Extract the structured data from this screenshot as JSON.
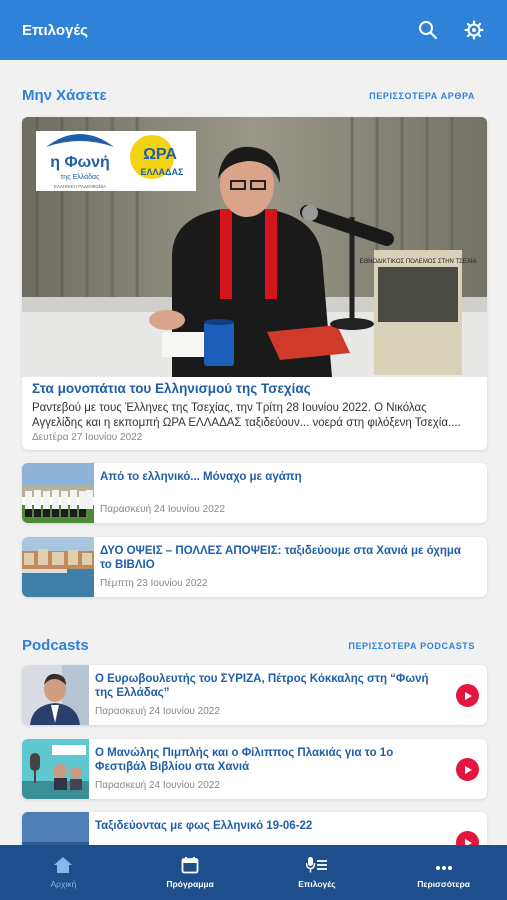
{
  "topbar": {
    "title": "Επιλογές",
    "search_icon": "search-icon",
    "settings_icon": "gear-icon"
  },
  "featured": {
    "title": "Μην Χάσετε",
    "more_label": "ΠΕΡΙΣΣΟΤΕΡΑ ΑΡΘΡΑ",
    "hero": {
      "title": "Στα μονοπάτια του Ελληνισμού της Τσεχίας",
      "summary": "Ραντεβού με τους Έλληνες της Τσεχίας, την Τρίτη 28 Ιουνίου 2022. Ο Νικόλας Αγγελίδης και η εκπομπή ΩΡΑ ΕΛΛΑΔΑΣ ταξιδεύουν... νοερά στη φιλόξενη Τσεχία....",
      "date": "Δευτέρα 27 Ιουνίου 2022",
      "logo_text_1": "η Φωνή",
      "logo_text_2": "της Ελλάδας",
      "logo_text_3": "ΕΛΛΗΝΙΚΗ ΡΑΔΙΟΦΩΝΙΑ",
      "logo_text_4": "ΩΡΑ",
      "logo_text_5": "ΕΛΛΑΔΑΣ",
      "book_text": "ΕΘΝΟΔΙΚΤΙΚΟΣ ΠΟΛΕΜΟΣ ΣΤΗΝ ΤΣΕΧΙΑ"
    },
    "articles": [
      {
        "title": "Από το ελληνικό... Μόναχο με αγάπη",
        "date": "Παρασκευή 24 Ιουνίου 2022"
      },
      {
        "title": "ΔΥΟ ΟΨΕΙΣ – ΠΟΛΛΕΣ ΑΠΟΨΕΙΣ: ταξιδεύουμε στα Χανιά με όχημα το ΒΙΒΛΙΟ",
        "date": "Πέμπτη 23 Ιουνίου 2022"
      }
    ]
  },
  "podcasts": {
    "title": "Podcasts",
    "more_label": "ΠΕΡΙΣΣΟΤΕΡΑ PODCASTS",
    "items": [
      {
        "title": "Ο Ευρωβουλευτής του ΣΥΡΙΖΑ, Πέτρος Κόκκαλης στη “Φωνή της Ελλάδας”",
        "date": "Παρασκευή 24 Ιουνίου 2022"
      },
      {
        "title": "Ο Μανώλης Πιμπλής και ο Φίλιππος Πλακιάς για το 1ο Φεστιβάλ Βιβλίου στα Χανιά",
        "date": "Παρασκευή 24 Ιουνίου 2022"
      },
      {
        "title": "Ταξιδεύοντας με φως Ελληνικό 19-06-22",
        "date": ""
      }
    ]
  },
  "bottom_nav": {
    "items": [
      {
        "label": "Αρχική",
        "icon": "home-icon",
        "active": true
      },
      {
        "label": "Πρόγραμμα",
        "icon": "calendar-icon",
        "active": false
      },
      {
        "label": "Επιλογές",
        "icon": "mic-list-icon",
        "active": false
      },
      {
        "label": "Περισσότερα",
        "icon": "more-icon",
        "active": false
      }
    ]
  },
  "colors": {
    "primary": "#2e82d8",
    "nav_bg": "#1d4f8c",
    "title_blue": "#1f5fa9",
    "play_red": "#e3163e"
  }
}
